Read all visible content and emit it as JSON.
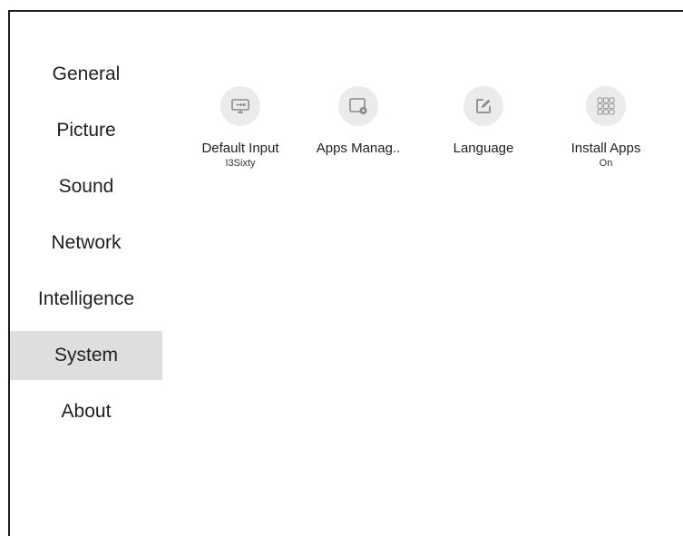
{
  "sidebar": {
    "items": [
      {
        "label": "General"
      },
      {
        "label": "Picture"
      },
      {
        "label": "Sound"
      },
      {
        "label": "Network"
      },
      {
        "label": "Intelligence"
      },
      {
        "label": "System",
        "selected": true
      },
      {
        "label": "About"
      }
    ]
  },
  "main": {
    "tiles": [
      {
        "label": "Default Input",
        "value": "I3Sixty",
        "icon": "input-source-icon"
      },
      {
        "label": "Apps Manag..",
        "value": "",
        "icon": "apps-manager-icon"
      },
      {
        "label": "Language",
        "value": "",
        "icon": "edit-icon"
      },
      {
        "label": "Install Apps",
        "value": "On",
        "icon": "grid-icon"
      }
    ]
  },
  "colors": {
    "selected_bg": "#dedede",
    "icon_circle": "#ebebeb",
    "icon_stroke": "#8a8a8a",
    "text": "#1f1f1f"
  }
}
